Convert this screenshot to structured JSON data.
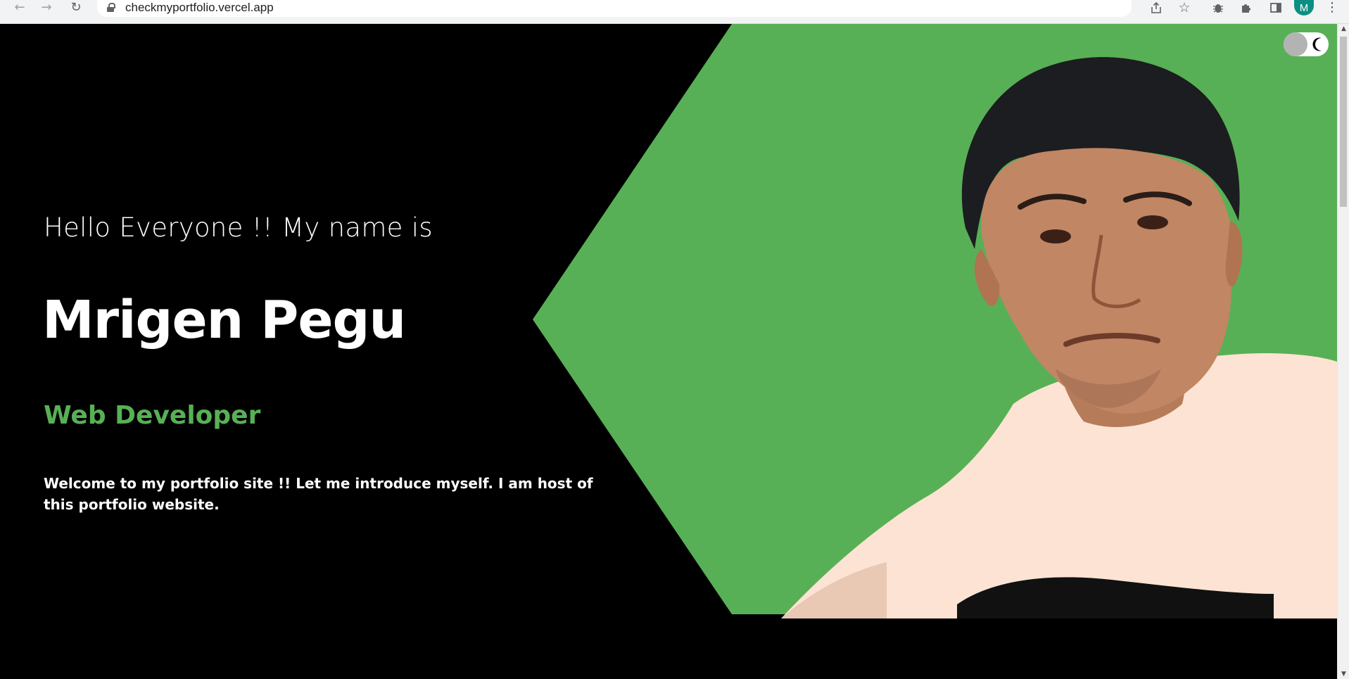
{
  "browser": {
    "url": "checkmyportfolio.vercel.app",
    "profile_initial": "M",
    "icons": {
      "back": "arrow-left",
      "forward": "arrow-right",
      "reload": "reload",
      "lock": "lock",
      "share": "share",
      "bookmark": "star",
      "extension": "bug-extension",
      "extensions": "puzzle",
      "side_panel": "side-panel",
      "menu": "kebab-menu"
    }
  },
  "hero": {
    "greeting": "Hello Everyone !! My name is",
    "name": "Mrigen Pegu",
    "role": "Web Developer",
    "intro": "Welcome to my portfolio site !! Let me introduce myself. I am host of this portfolio website."
  },
  "theme_toggle": {
    "icon": "moon-icon",
    "state": "dark"
  },
  "colors": {
    "accent_green": "#58b056",
    "background": "#000000",
    "text": "#ffffff",
    "toggle_knob": "#b3b3b3"
  }
}
